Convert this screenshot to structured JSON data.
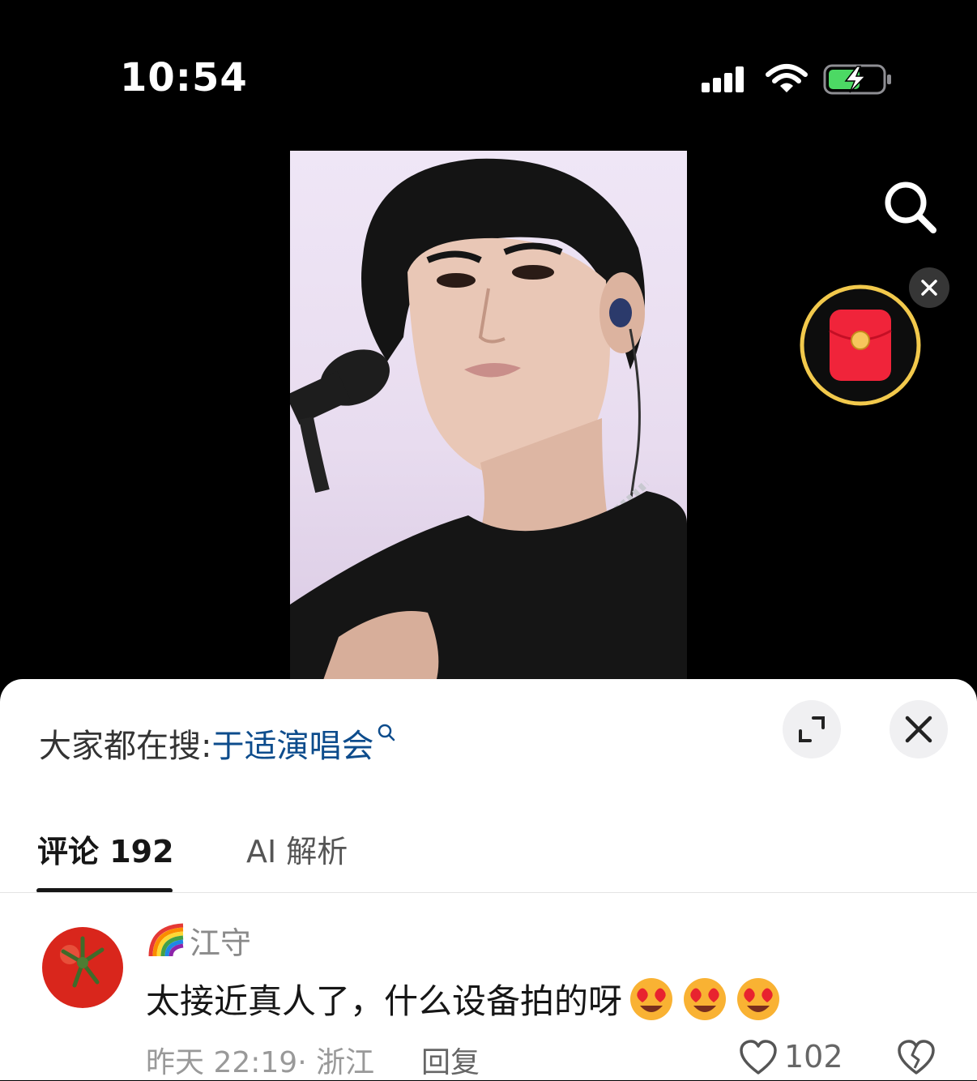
{
  "status_bar": {
    "time": "10:54"
  },
  "hot_search": {
    "label": "大家都在搜:",
    "term": "于适演唱会"
  },
  "tabs": [
    {
      "label": "评论 192"
    },
    {
      "label": "AI 解析"
    }
  ],
  "comment": {
    "username": "江守",
    "text": "太接近真人了，什么设备拍的呀",
    "time_location": "昨天 22:19· 浙江",
    "reply_label": "回复",
    "like_count": "102"
  },
  "icons": {
    "search": "search-icon",
    "red_packet": "red-envelope-icon",
    "expand": "expand-icon",
    "close": "close-icon",
    "like": "heart-outline-icon",
    "dislike": "broken-heart-icon",
    "emoji": "heart-eyes-emoji"
  },
  "colors": {
    "hot_term": "#0d4c8c",
    "battery_charge": "#4cd964",
    "red_packet": "#f0243a",
    "progress_ring": "#f2c94c"
  }
}
